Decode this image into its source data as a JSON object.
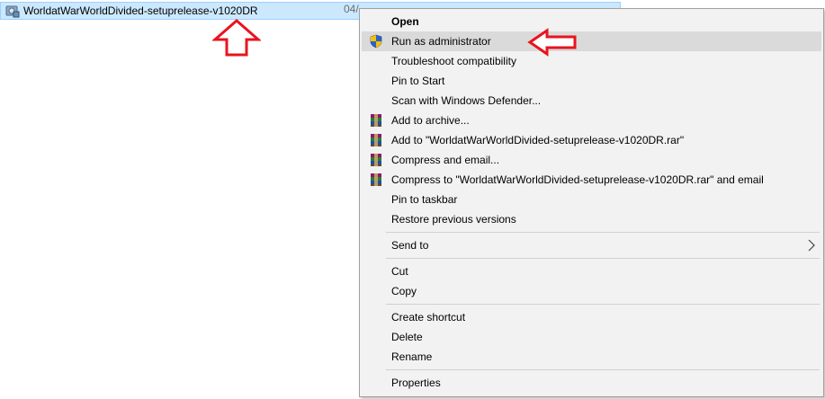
{
  "file": {
    "name": "WorldatWarWorldDivided-setuprelease-v1020DR",
    "date_fragment": "04/",
    "icon": "installer-icon"
  },
  "annotations": {
    "arrow_color": "#e8141e"
  },
  "menu": {
    "open": "Open",
    "run_as_admin": "Run as administrator",
    "troubleshoot": "Troubleshoot compatibility",
    "pin_start": "Pin to Start",
    "scan_defender": "Scan with Windows Defender...",
    "add_archive": "Add to archive...",
    "add_rar": "Add to \"WorldatWarWorldDivided-setuprelease-v1020DR.rar\"",
    "compress_email": "Compress and email...",
    "compress_rar_email": "Compress to \"WorldatWarWorldDivided-setuprelease-v1020DR.rar\" and email",
    "pin_taskbar": "Pin to taskbar",
    "restore_versions": "Restore previous versions",
    "send_to": "Send to",
    "cut": "Cut",
    "copy": "Copy",
    "create_shortcut": "Create shortcut",
    "delete": "Delete",
    "rename": "Rename",
    "properties": "Properties"
  }
}
